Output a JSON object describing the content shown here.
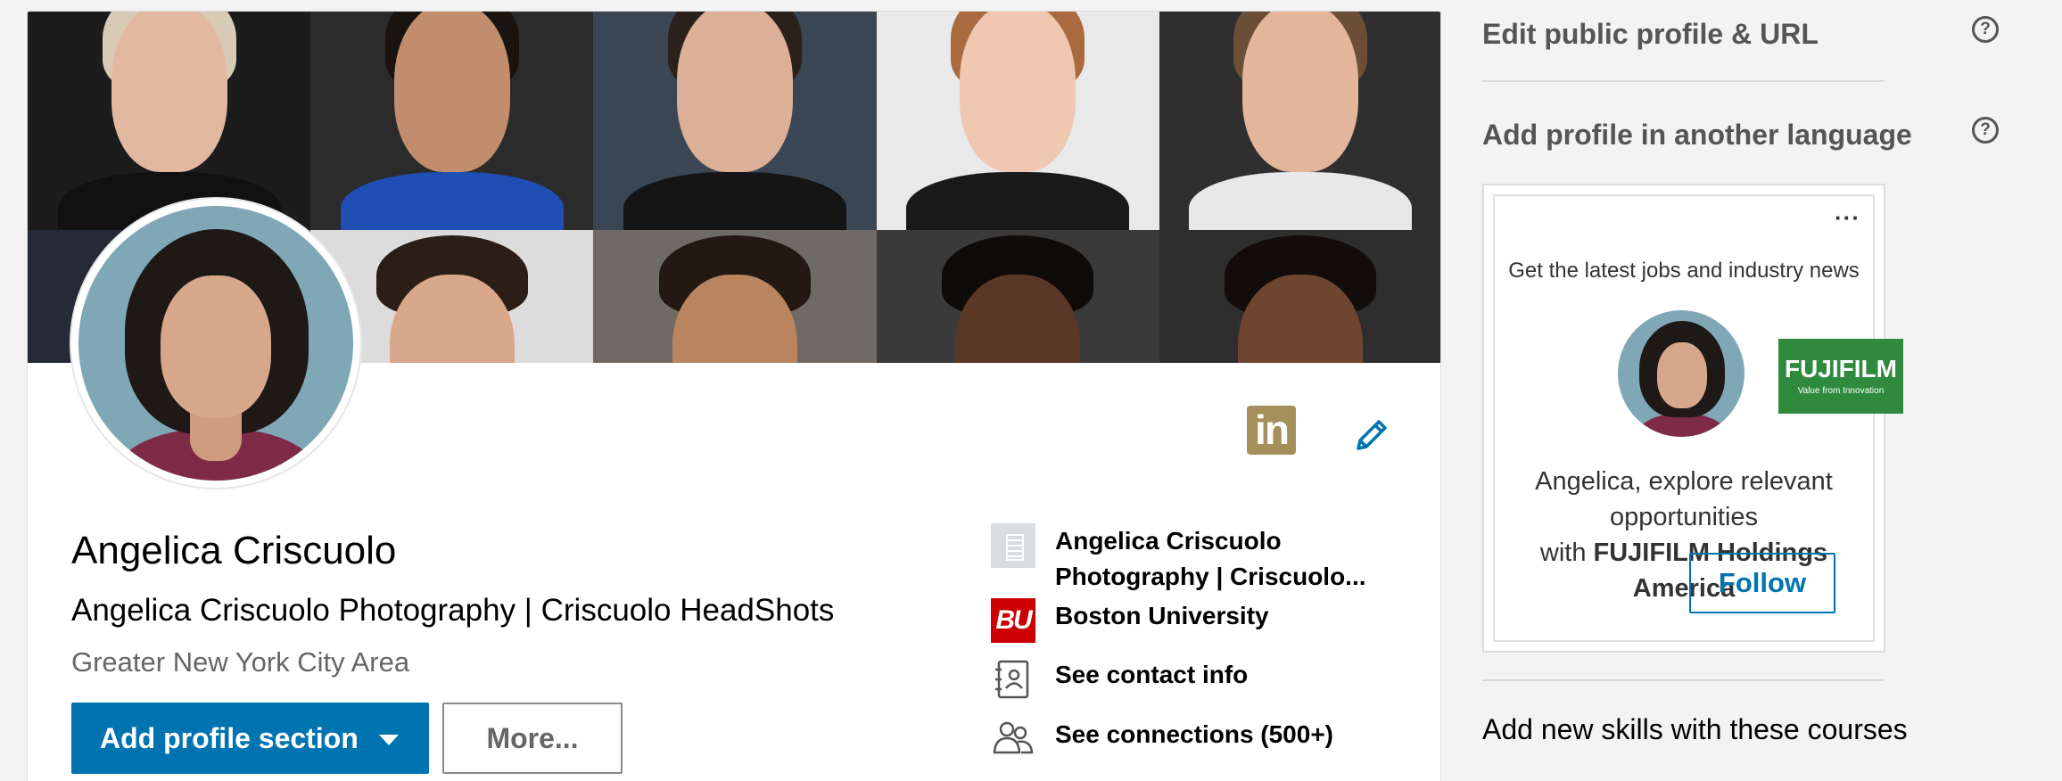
{
  "profile": {
    "name": "Angelica Criscuolo",
    "headline": "Angelica Criscuolo Photography | Criscuolo HeadShots",
    "location": "Greater New York City Area",
    "linkedin_badge": "in",
    "add_section_label": "Add profile section",
    "more_label": "More...",
    "info": {
      "company_line1": "Angelica Criscuolo",
      "company_line2": "Photography | Criscuolo...",
      "school": "Boston University",
      "school_logo": "BU",
      "contact": "See contact info",
      "connections": "See connections (500+)"
    }
  },
  "banner": {
    "tiles": [
      {
        "bg": "#1c1c1c",
        "skin": "#e2b9a0",
        "hair": "#d8cbb5",
        "shirt": "#111111"
      },
      {
        "bg": "#2b2b2b",
        "skin": "#c28d6c",
        "hair": "#1a1410",
        "shirt": "#1f4fb5"
      },
      {
        "bg": "#3b4654",
        "skin": "#dcb096",
        "hair": "#2a211b",
        "shirt": "#151515"
      },
      {
        "bg": "#e9e9e9",
        "skin": "#f0c7b0",
        "hair": "#a86a3e",
        "shirt": "#1a1a1a"
      },
      {
        "bg": "#2f2f2f",
        "skin": "#e3b59b",
        "hair": "#6b4e36",
        "shirt": "#e8e8e8"
      },
      {
        "bg": "#252a36",
        "skin": "#d6a486",
        "hair": "#1a1a1a",
        "shirt": "#333333"
      },
      {
        "bg": "#dcdcdc",
        "skin": "#d9a88a",
        "hair": "#2b1e16",
        "shirt": "#ffffff"
      },
      {
        "bg": "#6f6a66",
        "skin": "#b9855f",
        "hair": "#231812",
        "shirt": "#555555"
      },
      {
        "bg": "#3a3a3a",
        "skin": "#5a3826",
        "hair": "#0f0b09",
        "shirt": "#444444"
      },
      {
        "bg": "#2e2e2e",
        "skin": "#6e4630",
        "hair": "#120d0a",
        "shirt": "#555555"
      }
    ]
  },
  "rail": {
    "edit_public_profile": "Edit public profile & URL",
    "add_language": "Add profile in another language",
    "help_glyph": "?",
    "ad": {
      "menu": "···",
      "tagline": "Get the latest jobs and industry news",
      "company_logo_name": "FUJIFILM",
      "company_logo_sub": "Value from Innovation",
      "message_line1": "Angelica, explore relevant opportunities",
      "message_prefix": "with ",
      "company": "FUJIFILM Holdings America",
      "follow_label": "Follow"
    },
    "courses": "Add new skills with these courses"
  },
  "colors": {
    "primary_blue": "#0073b1",
    "linkedin_gold": "#a58f5b",
    "bu_red": "#cc0000",
    "fuji_green": "#2f8a3e",
    "page_bg": "#f3f3f3"
  },
  "icons": {
    "edit": "pencil-icon",
    "help": "question-circle-icon",
    "company": "building-icon",
    "contact": "address-book-icon",
    "connections": "people-icon",
    "dropdown": "caret-down-icon",
    "menu": "ellipsis-icon"
  }
}
